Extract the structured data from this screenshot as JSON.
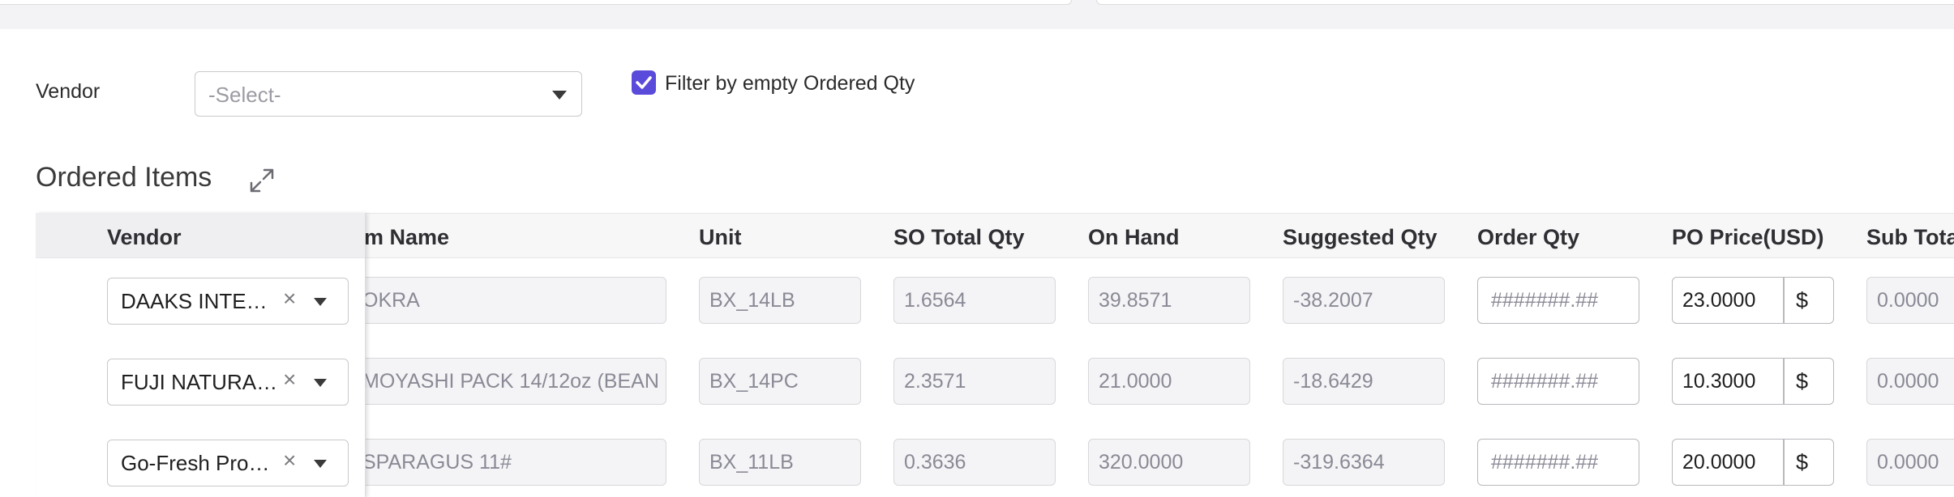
{
  "filters": {
    "vendor_label": "Vendor",
    "vendor_placeholder": "-Select-",
    "checkbox_label": "Filter by empty Ordered Qty",
    "checkbox_checked": true
  },
  "section": {
    "title": "Ordered Items"
  },
  "table": {
    "headers": {
      "vendor": "Vendor",
      "item_name": "em Name",
      "unit": "Unit",
      "so_total_qty": "SO Total Qty",
      "on_hand": "On Hand",
      "suggested_qty": "Suggested Qty",
      "order_qty": "Order Qty",
      "po_price": "PO Price(USD)",
      "sub_total": "Sub Tota"
    },
    "rows": [
      {
        "vendor": "DAAKS INTERNATIONAL",
        "item_name": "OKRA",
        "unit": "BX_14LB",
        "so_total_qty": "1.6564",
        "on_hand": "39.8571",
        "suggested_qty": "-38.2007",
        "order_qty_placeholder": "#######.##",
        "po_price": "23.0000",
        "currency": "$",
        "sub_total": "0.0000"
      },
      {
        "vendor": "FUJI NATURAL FOODS",
        "item_name": "MOYASHI PACK 14/12oz (BEAN",
        "unit": "BX_14PC",
        "so_total_qty": "2.3571",
        "on_hand": "21.0000",
        "suggested_qty": "-18.6429",
        "order_qty_placeholder": "#######.##",
        "po_price": "10.3000",
        "currency": "$",
        "sub_total": "0.0000"
      },
      {
        "vendor": "Go-Fresh Produce",
        "item_name": "SPARAGUS 11#",
        "unit": "BX_11LB",
        "so_total_qty": "0.3636",
        "on_hand": "320.0000",
        "suggested_qty": "-319.6364",
        "order_qty_placeholder": "#######.##",
        "po_price": "20.0000",
        "currency": "$",
        "sub_total": "0.0000"
      }
    ]
  },
  "colors": {
    "accent": "#5b4bdb",
    "header_bg": "#f7f7f8",
    "readonly_bg": "#f4f4f6"
  }
}
